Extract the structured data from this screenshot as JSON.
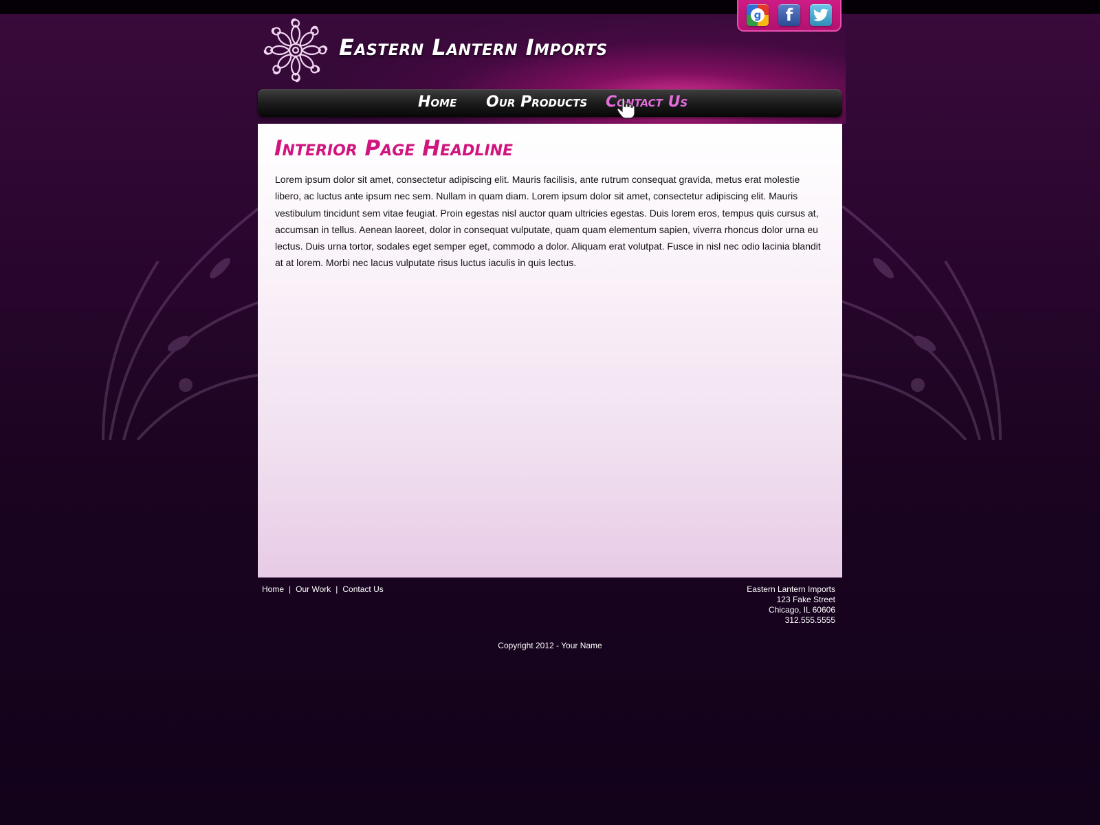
{
  "header": {
    "site_title": "Eastern Lantern Imports",
    "social": [
      {
        "name": "google",
        "glyph": "g"
      },
      {
        "name": "facebook",
        "glyph": "f"
      },
      {
        "name": "twitter",
        "glyph": "bird"
      }
    ]
  },
  "nav": {
    "items": [
      {
        "label": "Home",
        "active": false
      },
      {
        "label": "Our Products",
        "active": false
      },
      {
        "label": "Contact Us",
        "active": true
      }
    ]
  },
  "main": {
    "headline": "Interior Page Headline",
    "body": "Lorem ipsum dolor sit amet, consectetur adipiscing elit. Mauris facilisis, ante rutrum consequat gravida, metus erat molestie libero, ac luctus ante ipsum nec sem. Nullam in quam diam. Lorem ipsum dolor sit amet, consectetur adipiscing elit. Mauris vestibulum tincidunt sem vitae feugiat. Proin egestas nisl auctor quam ultricies egestas. Duis lorem eros, tempus quis cursus at, accumsan in tellus. Aenean laoreet, dolor in consequat vulputate, quam quam elementum sapien, viverra rhoncus dolor urna eu lectus. Duis urna tortor, sodales eget semper eget, commodo a dolor. Aliquam erat volutpat. Fusce in nisl nec odio lacinia blandit at at lorem. Morbi nec lacus vulputate risus luctus iaculis in quis lectus."
  },
  "footer": {
    "links": [
      "Home",
      "Our Work",
      "Contact Us"
    ],
    "separator": "|",
    "address": {
      "company": "Eastern Lantern Imports",
      "street": "123 Fake Street",
      "city": "Chicago, IL 60606",
      "phone": "312.555.5555"
    },
    "copyright": "Copyright 2012 - Your Name"
  },
  "colors": {
    "accent_pink": "#d0157f",
    "nav_active": "#e56ddc",
    "social_box": "#c01879"
  }
}
